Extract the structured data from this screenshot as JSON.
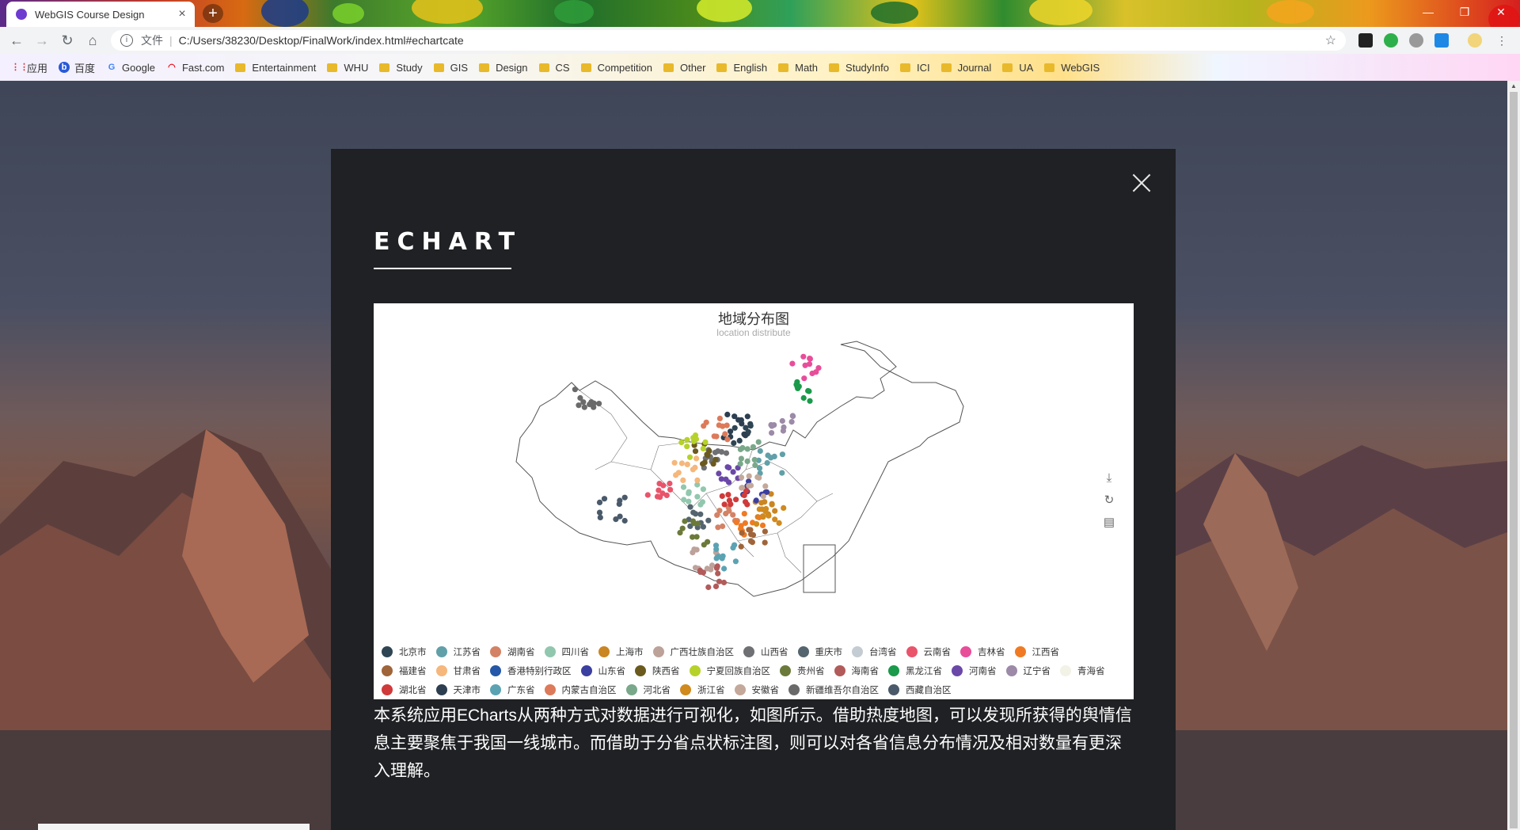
{
  "browser": {
    "tab_title": "WebGIS Course Design",
    "tab_close": "×",
    "new_tab": "+",
    "address_label": "文件",
    "address_url": "C:/Users/38230/Desktop/FinalWork/index.html#echartcate",
    "bookmarks": [
      "应用",
      "百度",
      "Google",
      "Fast.com",
      "Entertainment",
      "WHU",
      "Study",
      "GIS",
      "Design",
      "CS",
      "Competition",
      "Other",
      "English",
      "Math",
      "StudyInfo",
      "ICI",
      "Journal",
      "UA",
      "WebGIS"
    ]
  },
  "modal": {
    "heading": "ECHART",
    "description": "本系统应用ECharts从两种方式对数据进行可视化，如图所示。借助热度地图，可以发现所获得的舆情信息主要聚焦于我国一线城市。而借助于分省点状标注图，则可以对各省信息分布情况及相对数量有更深入理解。"
  },
  "chart_data": {
    "type": "scatter",
    "title": "地域分布图",
    "subtitle": "location distribute",
    "legend_position": "bottom",
    "toolbox": [
      "download-icon",
      "refresh-icon",
      "data-view-icon"
    ],
    "series": [
      {
        "name": "北京市",
        "color": "#2f4554"
      },
      {
        "name": "江苏省",
        "color": "#61a0a8"
      },
      {
        "name": "湖南省",
        "color": "#d48265"
      },
      {
        "name": "四川省",
        "color": "#91c7ae"
      },
      {
        "name": "上海市",
        "color": "#ca8622"
      },
      {
        "name": "广西壮族自治区",
        "color": "#bda29a"
      },
      {
        "name": "山西省",
        "color": "#6e7074"
      },
      {
        "name": "重庆市",
        "color": "#546570"
      },
      {
        "name": "台湾省",
        "color": "#c4ccd3"
      },
      {
        "name": "云南省",
        "color": "#e9546b"
      },
      {
        "name": "吉林省",
        "color": "#e84d9a"
      },
      {
        "name": "江西省",
        "color": "#f07a23"
      },
      {
        "name": "福建省",
        "color": "#a0643a"
      },
      {
        "name": "甘肃省",
        "color": "#f5b77b"
      },
      {
        "name": "香港特别行政区",
        "color": "#2557a8"
      },
      {
        "name": "山东省",
        "color": "#3b3fa0"
      },
      {
        "name": "陕西省",
        "color": "#6b5a1e"
      },
      {
        "name": "宁夏回族自治区",
        "color": "#b6d22a"
      },
      {
        "name": "贵州省",
        "color": "#6b7a3a"
      },
      {
        "name": "海南省",
        "color": "#b25b5b"
      },
      {
        "name": "黑龙江省",
        "color": "#1a9a4a"
      },
      {
        "name": "河南省",
        "color": "#6b48a8"
      },
      {
        "name": "辽宁省",
        "color": "#9c8aa8"
      },
      {
        "name": "青海省",
        "color": "#f2f2e6"
      },
      {
        "name": "湖北省",
        "color": "#d03a3a"
      },
      {
        "name": "天津市",
        "color": "#2c3e50"
      },
      {
        "name": "广东省",
        "color": "#5ba3b3"
      },
      {
        "name": "内蒙古自治区",
        "color": "#dd7a5a"
      },
      {
        "name": "河北省",
        "color": "#7aa88a"
      },
      {
        "name": "浙江省",
        "color": "#d08a1e"
      },
      {
        "name": "安徽省",
        "color": "#c4a89a"
      },
      {
        "name": "新疆维吾尔自治区",
        "color": "#6a6a6a"
      },
      {
        "name": "西藏自治区",
        "color": "#4a5a6a"
      }
    ]
  }
}
